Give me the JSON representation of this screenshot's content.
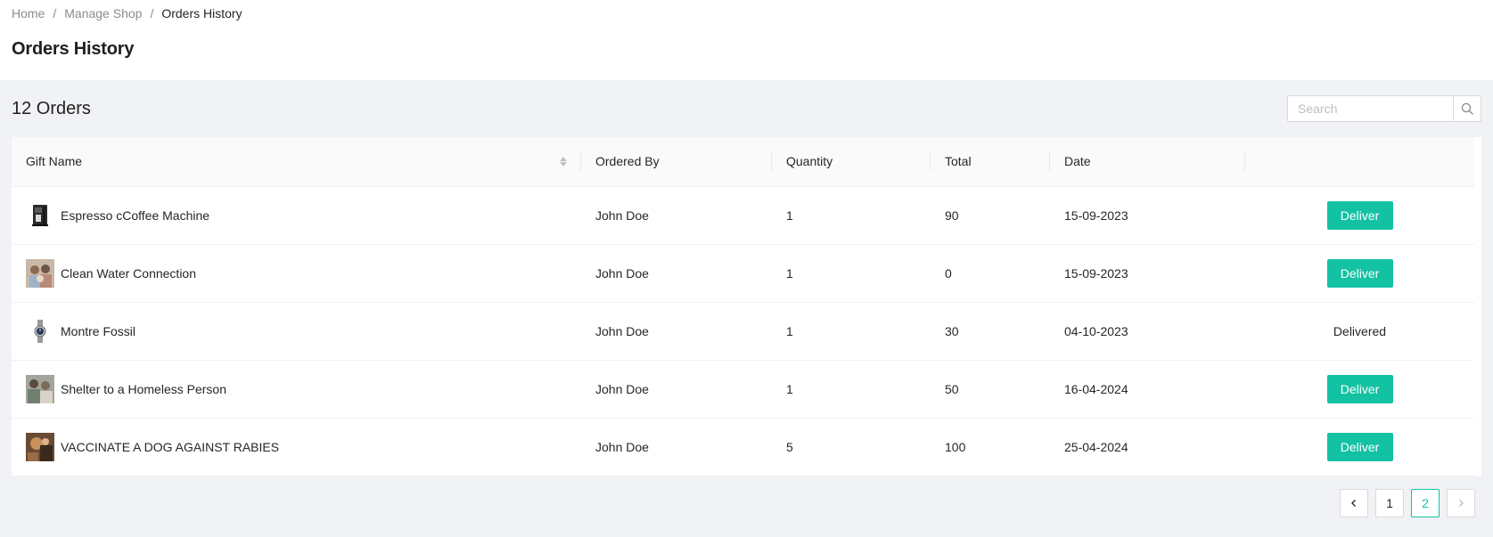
{
  "breadcrumb": {
    "items": [
      "Home",
      "Manage Shop"
    ],
    "current": "Orders History",
    "separator": "/"
  },
  "page": {
    "title": "Orders History"
  },
  "orders": {
    "count_label": "12 Orders"
  },
  "search": {
    "placeholder": "Search",
    "value": ""
  },
  "table": {
    "headers": {
      "gift_name": "Gift Name",
      "ordered_by": "Ordered By",
      "quantity": "Quantity",
      "total": "Total",
      "date": "Date",
      "action": ""
    },
    "rows": [
      {
        "gift_name": "Espresso cCoffee Machine",
        "thumb_icon": "coffee-machine-image",
        "ordered_by": "John Doe",
        "quantity": "1",
        "total": "90",
        "date": "15-09-2023",
        "action": "Deliver",
        "action_type": "button"
      },
      {
        "gift_name": "Clean Water Connection",
        "thumb_icon": "people-photo-image",
        "ordered_by": "John Doe",
        "quantity": "1",
        "total": "0",
        "date": "15-09-2023",
        "action": "Deliver",
        "action_type": "button"
      },
      {
        "gift_name": "Montre Fossil",
        "thumb_icon": "watch-image",
        "ordered_by": "John Doe",
        "quantity": "1",
        "total": "30",
        "date": "04-10-2023",
        "action": "Delivered",
        "action_type": "text"
      },
      {
        "gift_name": "Shelter to a Homeless Person",
        "thumb_icon": "family-photo-image",
        "ordered_by": "John Doe",
        "quantity": "1",
        "total": "50",
        "date": "16-04-2024",
        "action": "Deliver",
        "action_type": "button"
      },
      {
        "gift_name": "VACCINATE A DOG AGAINST RABIES",
        "thumb_icon": "dog-photo-image",
        "ordered_by": "John Doe",
        "quantity": "5",
        "total": "100",
        "date": "25-04-2024",
        "action": "Deliver",
        "action_type": "button"
      }
    ]
  },
  "pagination": {
    "pages": [
      "1",
      "2"
    ],
    "current": "2",
    "prev_icon": "chevron-left-icon",
    "next_icon": "chevron-right-icon"
  },
  "colors": {
    "accent": "#13c2a3",
    "background": "#f0f2f5",
    "header_bg": "#fafafa"
  }
}
